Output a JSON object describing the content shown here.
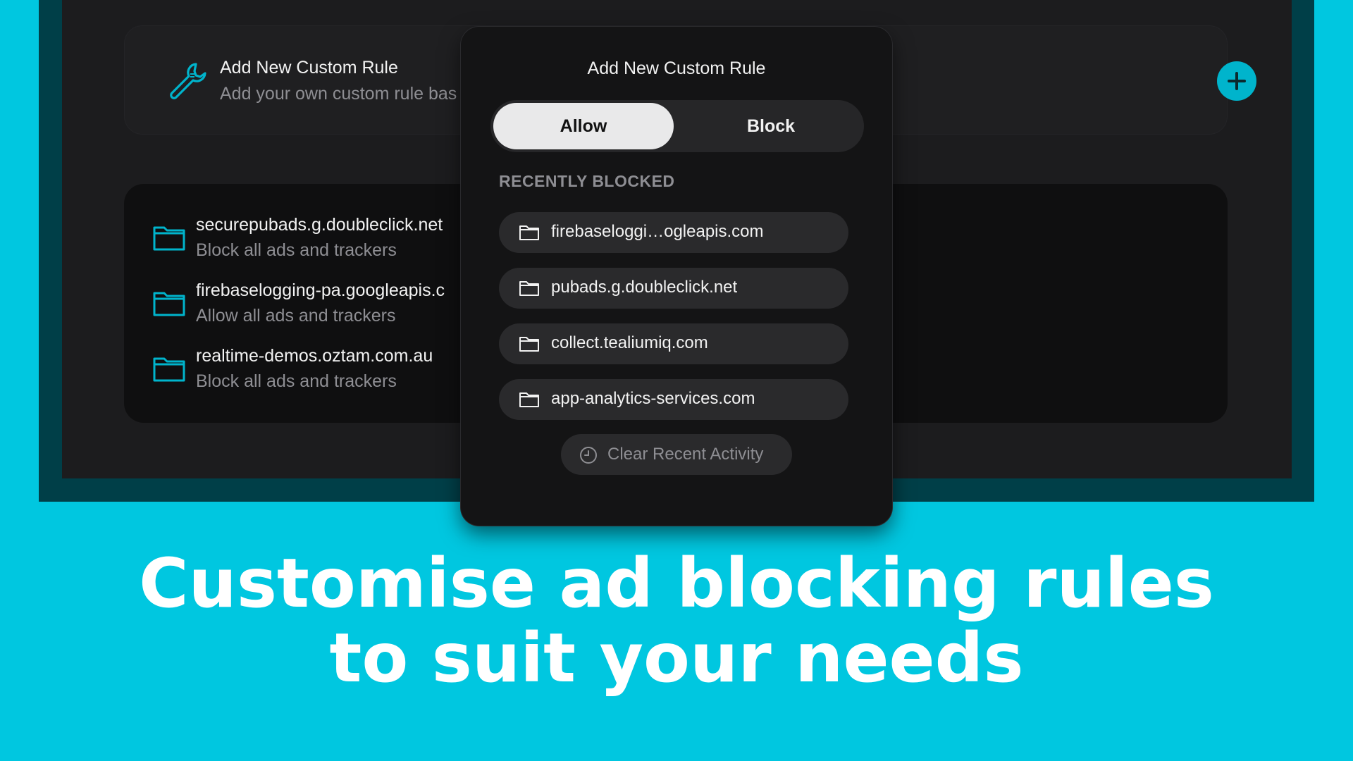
{
  "rule_card": {
    "title": "Add New Custom Rule",
    "subtitle": "Add your own custom rule bas",
    "icon": "wrench-icon",
    "add_icon": "plus-icon"
  },
  "rules_list": [
    {
      "domain": "securepubads.g.doubleclick.net",
      "description": "Block all ads and trackers",
      "icon": "folder-icon"
    },
    {
      "domain": "firebaselogging-pa.googleapis.c",
      "description": "Allow all ads and trackers",
      "icon": "folder-icon"
    },
    {
      "domain": "realtime-demos.oztam.com.au",
      "description": "Block all ads and trackers",
      "icon": "folder-icon"
    }
  ],
  "modal": {
    "title": "Add New Custom Rule",
    "segment": {
      "allow_label": "Allow",
      "block_label": "Block",
      "selected": "Allow"
    },
    "section_label": "RECENTLY BLOCKED",
    "recent": [
      "firebaseloggi…ogleapis.com",
      "pubads.g.doubleclick.net",
      "collect.tealiumiq.com",
      "app-analytics-services.com"
    ],
    "clear_label": "Clear Recent Activity",
    "clear_icon": "clock-icon"
  },
  "headline": {
    "line1": "Customise ad blocking rules",
    "line2": "to suit your needs"
  },
  "colors": {
    "background": "#00c7e0",
    "accent": "#00b4cc",
    "frame": "#003f48"
  }
}
